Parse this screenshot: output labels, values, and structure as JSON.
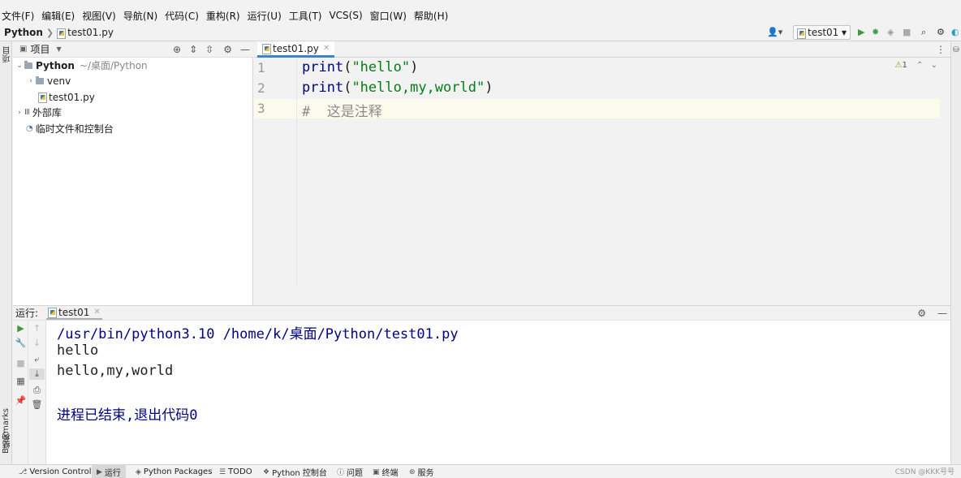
{
  "menu": [
    "文件(F)",
    "编辑(E)",
    "视图(V)",
    "导航(N)",
    "代码(C)",
    "重构(R)",
    "运行(U)",
    "工具(T)",
    "VCS(S)",
    "窗口(W)",
    "帮助(H)"
  ],
  "navbar": {
    "root": "Python",
    "file": "test01.py"
  },
  "toolbar": {
    "run_config": "test01"
  },
  "left_strip": {
    "project": "项目",
    "bookmarks": "Bookmarks",
    "structure": "结构"
  },
  "project_panel": {
    "title": "项目",
    "root_name": "Python",
    "root_path": "~/桌面/Python",
    "items": [
      "venv",
      "test01.py",
      "外部库",
      "临时文件和控制台"
    ]
  },
  "editor": {
    "tab": "test01.py",
    "warnings": "1",
    "line_numbers": [
      "1",
      "2",
      "3"
    ],
    "lines": [
      {
        "func": "print",
        "open": "(",
        "string": "\"hello\"",
        "close": ")"
      },
      {
        "func": "print",
        "open": "(",
        "string": "\"hello,my,world\"",
        "close": ")"
      },
      {
        "comment": "#  这是注释"
      }
    ]
  },
  "run_panel": {
    "label": "运行:",
    "tab": "test01",
    "output": [
      "/usr/bin/python3.10 /home/k/桌面/Python/test01.py",
      "hello",
      "hello,my,world",
      "",
      "进程已结束,退出代码0"
    ]
  },
  "bottom_tools": [
    "Version Control",
    "运行",
    "Python Packages",
    "TODO",
    "Python 控制台",
    "问题",
    "终端",
    "服务"
  ],
  "watermark": "CSDN @KKK号号"
}
